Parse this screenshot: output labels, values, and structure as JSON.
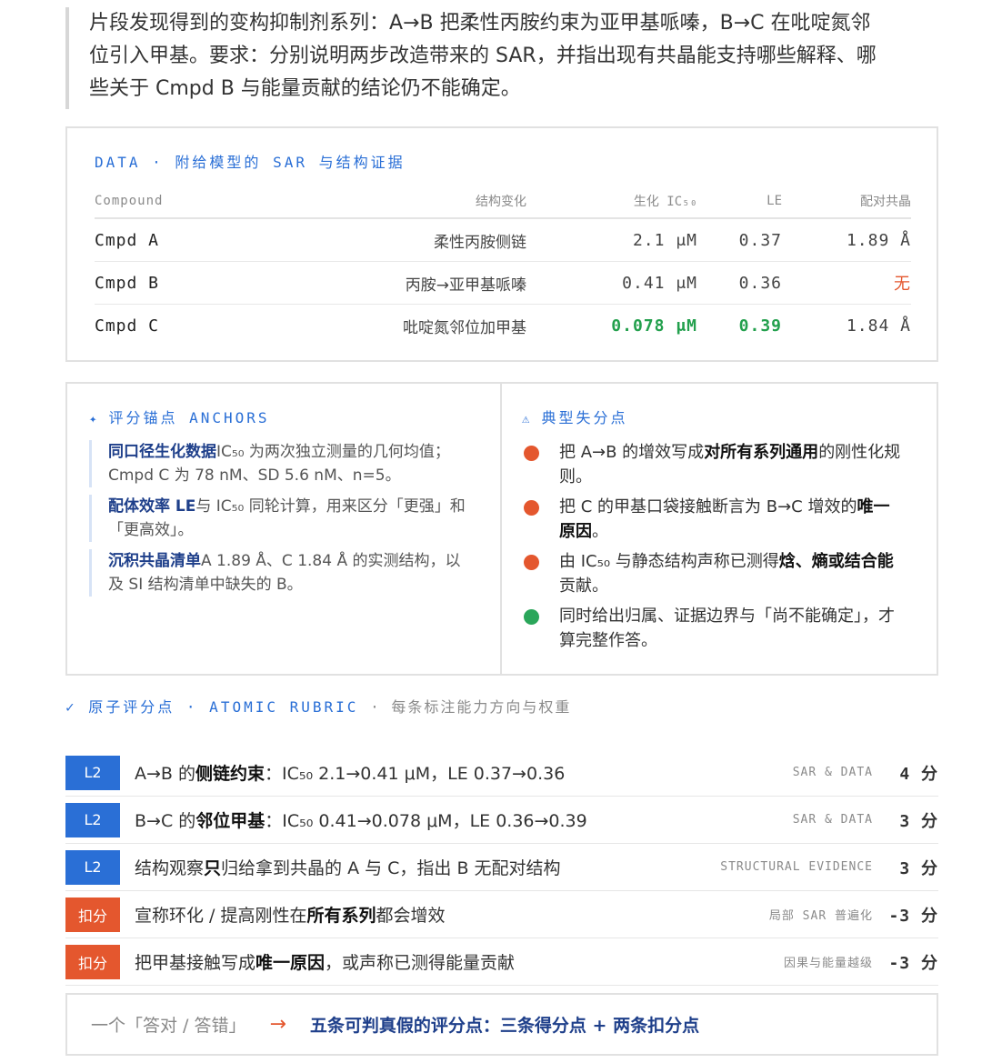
{
  "intro": {
    "line1": "片段发现得到的变构抑制剂系列：A→B 把柔性丙胺约束为亚甲基哌嗪，B→C 在吡啶氮邻",
    "line2": "位引入甲基。要求：分别说明两步改造带来的 SAR，并指出现有共晶能支持哪些解释、哪",
    "line3": "些关于 Cmpd B 与能量贡献的结论仍不能确定。"
  },
  "data_panel": {
    "title": "DATA · 附给模型的 SAR 与结构证据",
    "headers": [
      "Compound",
      "结构变化",
      "生化 IC₅₀",
      "LE",
      "配对共晶"
    ],
    "rows": [
      {
        "compound": "Cmpd A",
        "change": "柔性丙胺侧链",
        "ic50": "2.1 μM",
        "le": "0.37",
        "cocrystal": "1.89 Å"
      },
      {
        "compound": "Cmpd B",
        "change": "丙胺→亚甲基哌嗪",
        "ic50": "0.41 μM",
        "le": "0.36",
        "cocrystal": "无"
      },
      {
        "compound": "Cmpd C",
        "change": "吡啶氮邻位加甲基",
        "ic50": "0.078 μM",
        "le": "0.39",
        "cocrystal": "1.84 Å"
      }
    ]
  },
  "anchors": {
    "title": "评分锚点 ANCHORS",
    "items": [
      {
        "bold": "同口径生化数据",
        "text": "IC₅₀ 为两次独立测量的几何均值；Cmpd C 为 78 nM、SD 5.6 nM、n=5。"
      },
      {
        "bold": "配体效率 LE",
        "text": "与 IC₅₀ 同轮计算，用来区分「更强」和「更高效」。"
      },
      {
        "bold": "沉积共晶清单",
        "text": "A 1.89 Å、C 1.84 Å 的实测结构，以及 SI 结构清单中缺失的 B。"
      }
    ]
  },
  "mistakes": {
    "title": "典型失分点",
    "items": [
      {
        "pre": "把 A→B 的增效写成",
        "bold": "对所有系列通用",
        "post": "的刚性化规则。",
        "color": "red"
      },
      {
        "pre": "把 C 的甲基口袋接触断言为 B→C 增效的",
        "bold": "唯一原因",
        "post": "。",
        "color": "red"
      },
      {
        "pre": "由 IC₅₀ 与静态结构声称已测得",
        "bold": "焓、熵或结合能",
        "post": "贡献。",
        "color": "red"
      },
      {
        "pre": "同时给出归属、证据边界与「尚不能确定」，才算完整作答。",
        "bold": "",
        "post": "",
        "color": "green"
      }
    ]
  },
  "rubric": {
    "title": "原子评分点 · ATOMIC RUBRIC",
    "subtitle": "· 每条标注能力方向与权重",
    "rows": [
      {
        "badge": "L2",
        "type": "blue",
        "pre": "A→B 的",
        "bold": "侧链约束",
        "post": "：IC₅₀ 2.1→0.41 μM，LE 0.37→0.36",
        "tag": "SAR & DATA",
        "points": "4",
        "unit": "分"
      },
      {
        "badge": "L2",
        "type": "blue",
        "pre": "B→C 的",
        "bold": "邻位甲基",
        "post": "：IC₅₀ 0.41→0.078 μM，LE 0.36→0.39",
        "tag": "SAR & DATA",
        "points": "3",
        "unit": "分"
      },
      {
        "badge": "L2",
        "type": "blue",
        "pre": "结构观察",
        "bold": "只",
        "post": "归给拿到共晶的 A 与 C，指出 B 无配对结构",
        "tag": "STRUCTURAL EVIDENCE",
        "points": "3",
        "unit": "分"
      },
      {
        "badge": "扣分",
        "type": "orange",
        "pre": "宣称环化 / 提高刚性在",
        "bold": "所有系列",
        "post": "都会增效",
        "tag": "局部 SAR 普遍化",
        "points": "-3",
        "unit": "分"
      },
      {
        "badge": "扣分",
        "type": "orange",
        "pre": "把甲基接触写成",
        "bold": "唯一原因",
        "post": "，或声称已测得能量贡献",
        "tag": "因果与能量越级",
        "points": "-3",
        "unit": "分"
      }
    ]
  },
  "summary": {
    "left": "一个「答对 / 答错」",
    "arrow": "→",
    "right": "五条可判真假的评分点：三条得分点 + 两条扣分点"
  },
  "colors": {
    "accent": "#2a6fd6",
    "penalty": "#e4572e",
    "good": "#23a04d"
  }
}
